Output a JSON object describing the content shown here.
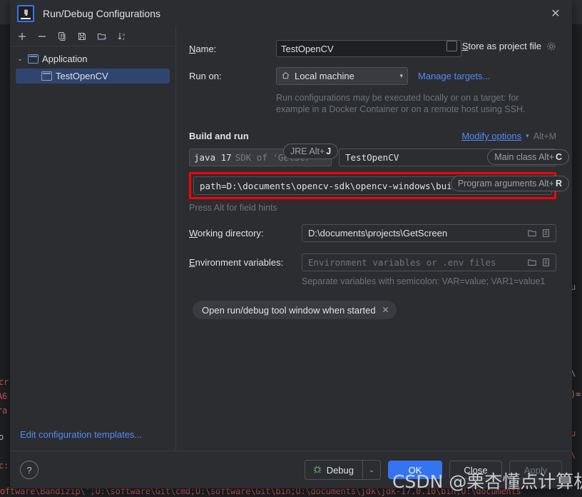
{
  "window": {
    "title": "Run/Debug Configurations",
    "logo_text": "IJ",
    "close_label": "✕"
  },
  "toolbar": {
    "add": "+",
    "remove": "−",
    "copy": "copy",
    "save": "save",
    "folder": "folder",
    "sort": "sort"
  },
  "tree": {
    "group_label": "Application",
    "selected_label": "TestOpenCV",
    "chevron": "⌄"
  },
  "left_pane": {
    "edit_templates": "Edit configuration templates..."
  },
  "form": {
    "name_label": "Name:",
    "name_label_mnemonic": "N",
    "name_value": "TestOpenCV",
    "store_as_project_file": "Store as project file",
    "store_mnemonic": "S",
    "run_on_label": "Run on:",
    "run_on_value": "Local machine",
    "run_on_icon": "home-icon",
    "manage_targets": "Manage targets...",
    "run_hint_line1": "Run configurations may be executed locally or on a target: for",
    "run_hint_line2": "example in a Docker Container or on a remote host using SSH."
  },
  "build_and_run": {
    "section_title": "Build and run",
    "modify_options": "Modify options",
    "modify_mnemonic": "M",
    "modify_shortcut": "Alt+M",
    "jre_bubble_text": "JRE Alt+",
    "jre_bubble_key": "J",
    "main_class_bubble_text": "Main class Alt+",
    "main_class_bubble_key": "C",
    "program_args_bubble_text": "Program arguments Alt+",
    "program_args_bubble_key": "R",
    "sdk_value_bold": "java 17",
    "sdk_value_dim": "SDK of 'GetScr",
    "main_class_value": "TestOpenCV",
    "program_arguments_value": "path=D:\\documents\\opencv-sdk\\opencv-windows\\build\\java\\x64",
    "press_alt_hint": "Press Alt for field hints",
    "highlight_color": "#ff0000"
  },
  "lower_form": {
    "working_directory_label": "Working directory:",
    "working_directory_mnemonic": "W",
    "working_directory_value": "D:\\documents\\projects\\GetScreen",
    "environment_variables_label": "Environment variables:",
    "environment_variables_mnemonic": "E",
    "environment_variables_placeholder": "Environment variables or .env files",
    "separate_hint": "Separate variables with semicolon: VAR=value; VAR1=value1",
    "chip_label": "Open run/debug tool window when started",
    "chip_close": "✕"
  },
  "footer": {
    "help": "?",
    "debug": "Debug",
    "debug_arrow": "⌄",
    "ok": "OK",
    "close": "Close",
    "apply": "Apply",
    "ok_color": "#3574F0"
  },
  "watermark": {
    "text": "CSDN @栗杏懂点计算机"
  },
  "background_console": {
    "bottom_line": "oftware\\Bandizip\\';U:\\software\\Git\\cmd;U:\\software\\Git\\bin;U:\\documents\\jdk\\jdk-17.0.10\\bin;U:\\documents",
    "left_line_1": "cr",
    "left_line_2": "A6",
    "left_line_3": "ra",
    "left_line_4": "o",
    "left_line_5": "c:",
    "right_line_1": "u",
    "right_line_2": "\\",
    "right_line_3": ")=",
    "right_line_4": "u",
    "right_line_5": "\\"
  }
}
